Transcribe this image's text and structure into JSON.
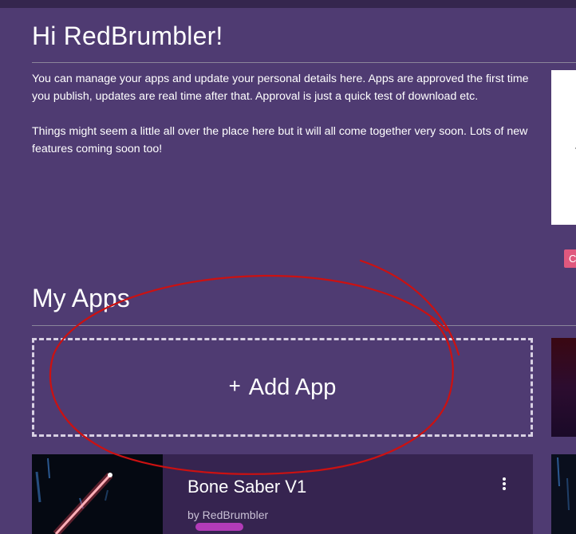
{
  "header": {
    "greeting": "Hi RedBrumbler!"
  },
  "intro": {
    "paragraph_1": "You can manage your apps and update your personal details here. Apps are approved the first time you publish, updates are real time after that. Approval is just a quick test of download etc.",
    "paragraph_2": "Things might seem a little all over the place here but it will all come together very soon. Lots of new features coming soon too!"
  },
  "side_panel": {
    "tag_label": "C"
  },
  "my_apps": {
    "title": "My Apps",
    "add_app": {
      "icon_glyph": "+",
      "label": "Add App"
    },
    "apps": [
      {
        "name": "Bone Saber V1",
        "author": "by RedBrumbler",
        "menu_icon": "more-vertical-icon"
      }
    ]
  },
  "colors": {
    "background": "#4f3b72",
    "top_bar": "#35264e",
    "card": "#362450",
    "tag": "#e0587e",
    "badge": "#b23bb8",
    "annotation_stroke": "#cc1111"
  }
}
